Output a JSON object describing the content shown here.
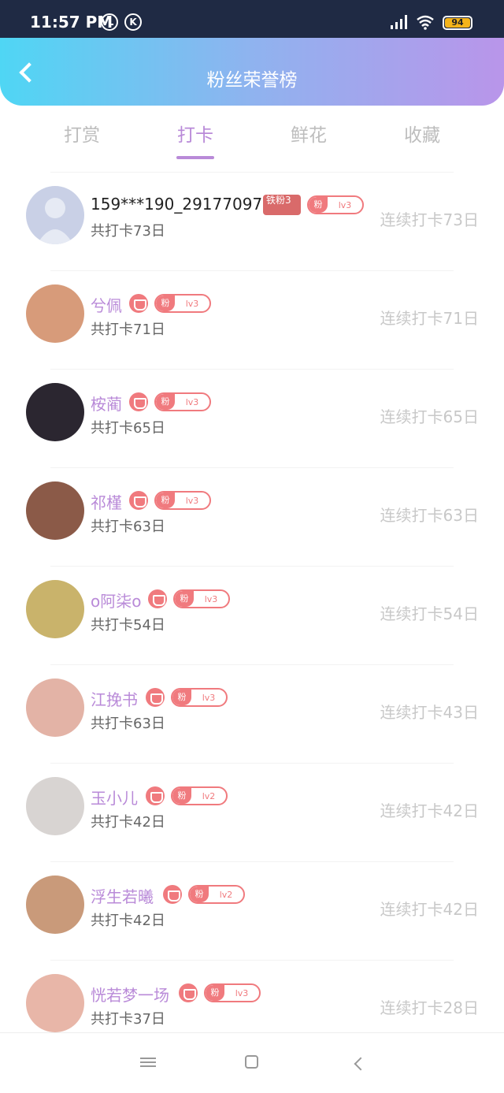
{
  "status_bar": {
    "time": "11:57 PM",
    "k_label": "K",
    "battery_level": "94"
  },
  "header": {
    "title": "粉丝荣誉榜"
  },
  "tabs": [
    {
      "label": "打赏",
      "active": false
    },
    {
      "label": "打卡",
      "active": true
    },
    {
      "label": "鲜花",
      "active": false
    },
    {
      "label": "收藏",
      "active": false
    }
  ],
  "list": [
    {
      "name": "159***190_291770970",
      "total": "共打卡73日",
      "streak": "连续打卡73日",
      "tie_label": "铁粉3",
      "fan_label": "粉",
      "level": "lv3",
      "avatar_color": "#c9d0e6"
    },
    {
      "name": "兮佩",
      "total": "共打卡71日",
      "streak": "连续打卡71日",
      "fan_label": "粉",
      "level": "lv3",
      "avatar_color": "#d79b7a"
    },
    {
      "name": "桉蔺",
      "total": "共打卡65日",
      "streak": "连续打卡65日",
      "fan_label": "粉",
      "level": "lv3",
      "avatar_color": "#2b2630"
    },
    {
      "name": "祁槿",
      "total": "共打卡63日",
      "streak": "连续打卡63日",
      "fan_label": "粉",
      "level": "lv3",
      "avatar_color": "#8b5a48"
    },
    {
      "name": "o阿柒o",
      "total": "共打卡54日",
      "streak": "连续打卡54日",
      "fan_label": "粉",
      "level": "lv3",
      "avatar_color": "#c9b36b"
    },
    {
      "name": "江挽书",
      "total": "共打卡63日",
      "streak": "连续打卡43日",
      "fan_label": "粉",
      "level": "lv3",
      "avatar_color": "#e3b3a6"
    },
    {
      "name": "玉小儿",
      "total": "共打卡42日",
      "streak": "连续打卡42日",
      "fan_label": "粉",
      "level": "lv2",
      "avatar_color": "#d8d4d2"
    },
    {
      "name": "浮生若曦",
      "total": "共打卡42日",
      "streak": "连续打卡42日",
      "fan_label": "粉",
      "level": "lv2",
      "avatar_color": "#c99a7a"
    },
    {
      "name": "恍若梦一场",
      "total": "共打卡37日",
      "streak": "连续打卡28日",
      "fan_label": "粉",
      "level": "lv3",
      "avatar_color": "#e8b6a8"
    }
  ],
  "colors": {
    "accent": "#b98ad8",
    "badge": "#f07a7e",
    "tie_badge": "#d96a6a"
  }
}
